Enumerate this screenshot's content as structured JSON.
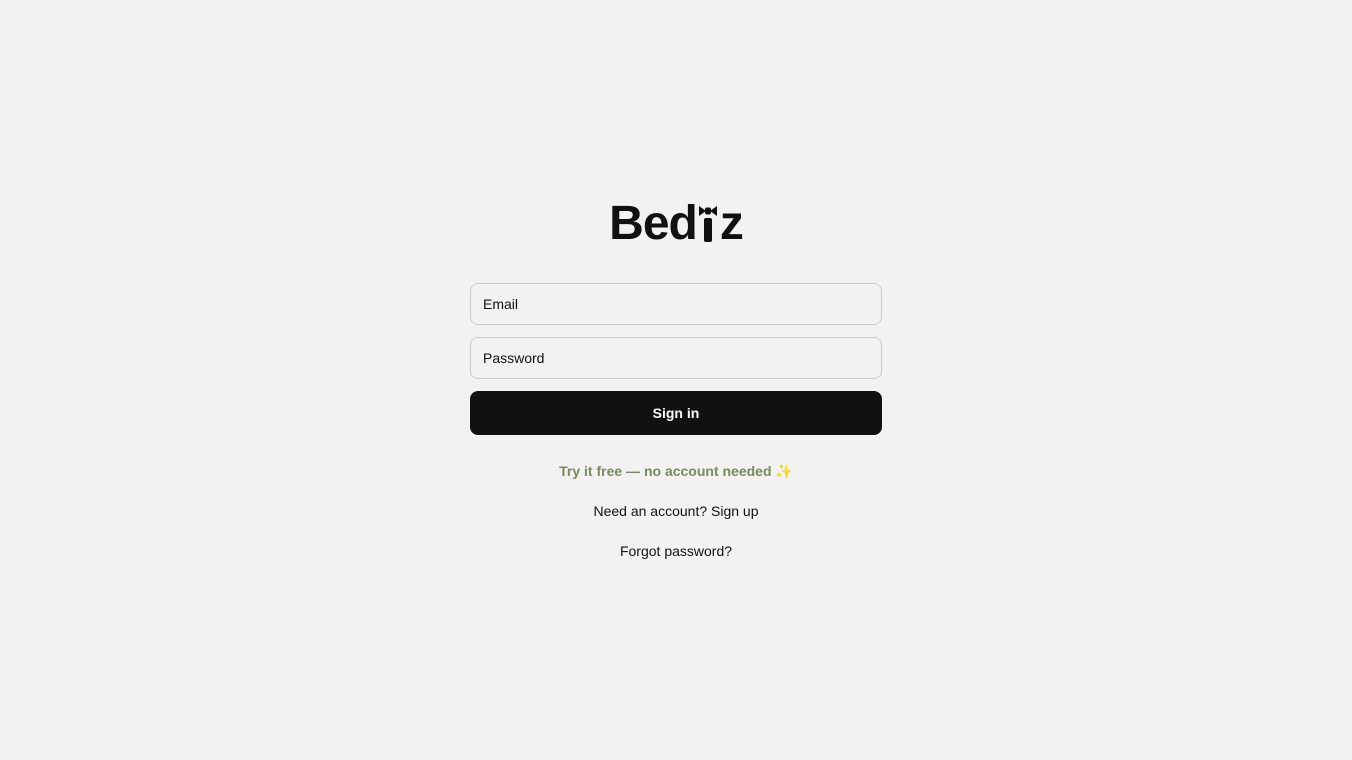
{
  "brand": {
    "logo_prefix": "Bed",
    "logo_suffix": "z",
    "logo_alt": "Bediz"
  },
  "form": {
    "email_placeholder": "Email",
    "password_placeholder": "Password",
    "signin_label": "Sign in"
  },
  "links": {
    "try_free": "Try it free — no account needed",
    "try_free_emoji": "✨",
    "signup": "Need an account? Sign up",
    "forgot": "Forgot password?"
  },
  "colors": {
    "background": "#f2f2f2",
    "primary": "#111111",
    "accent": "#7a8a5c"
  },
  "icons": {
    "logo_i": "bowtie-i-icon"
  }
}
